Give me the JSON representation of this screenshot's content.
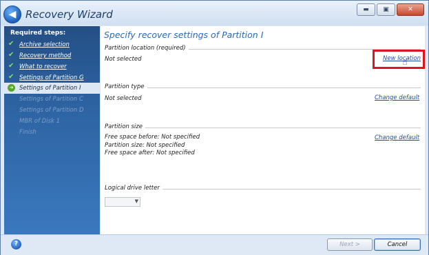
{
  "window": {
    "title": "Recovery Wizard",
    "controls": {
      "minimize": "▬",
      "maximize": "▣",
      "close": "✕"
    }
  },
  "sidebar": {
    "heading": "Required steps:",
    "steps": [
      {
        "label": "Archive selection",
        "state": "done"
      },
      {
        "label": "Recovery method",
        "state": "done"
      },
      {
        "label": "What to recover",
        "state": "done"
      },
      {
        "label": "Settings of Partition G",
        "state": "done"
      },
      {
        "label": "Settings of Partition I",
        "state": "current"
      },
      {
        "label": "Settings of Partition C",
        "state": "todo"
      },
      {
        "label": "Settings of Partition D",
        "state": "todo"
      },
      {
        "label": "MBR of Disk 1",
        "state": "todo"
      },
      {
        "label": "Finish",
        "state": "todo"
      }
    ],
    "check_glyph": "✔",
    "current_glyph": "➔"
  },
  "main": {
    "title": "Specify recover settings of Partition I",
    "partition_location": {
      "label": "Partition location (required)",
      "value": "Not selected",
      "action": "New location"
    },
    "partition_type": {
      "label": "Partition type",
      "value": "Not selected",
      "action": "Change default"
    },
    "partition_size": {
      "label": "Partition size",
      "free_before": "Free space before: Not specified",
      "size": "Partition size: Not specified",
      "free_after": "Free space after: Not specified",
      "action": "Change default"
    },
    "logical_drive": {
      "label": "Logical drive letter",
      "selected": ""
    }
  },
  "footer": {
    "help": "?",
    "next": "Next >",
    "cancel": "Cancel"
  },
  "colors": {
    "highlight": "#e0141e",
    "link": "#1e4ea5",
    "title": "#2a69b4"
  },
  "icons": {
    "back": "back-arrow-icon",
    "help": "help-icon",
    "cursor": "hand-pointer-icon"
  }
}
